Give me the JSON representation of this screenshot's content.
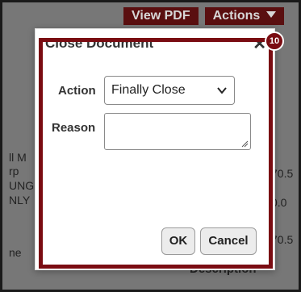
{
  "toolbar": {
    "view_pdf_label": "View PDF",
    "actions_label": "Actions"
  },
  "background": {
    "left_fragments": [
      "ll M",
      "rp",
      "UNG",
      "NLY"
    ],
    "left_bottom_fragment": "ne",
    "right_fragments": [
      "70.5",
      "0.0",
      "70.5"
    ],
    "column_header": "Description"
  },
  "dialog": {
    "title": "Close Document",
    "close_glyph": "✕",
    "action_label": "Action",
    "action_value": "Finally Close",
    "reason_label": "Reason",
    "reason_value": "",
    "ok_label": "OK",
    "cancel_label": "Cancel"
  },
  "annotation": {
    "badge_number": "10",
    "color": "#7a0c12"
  }
}
